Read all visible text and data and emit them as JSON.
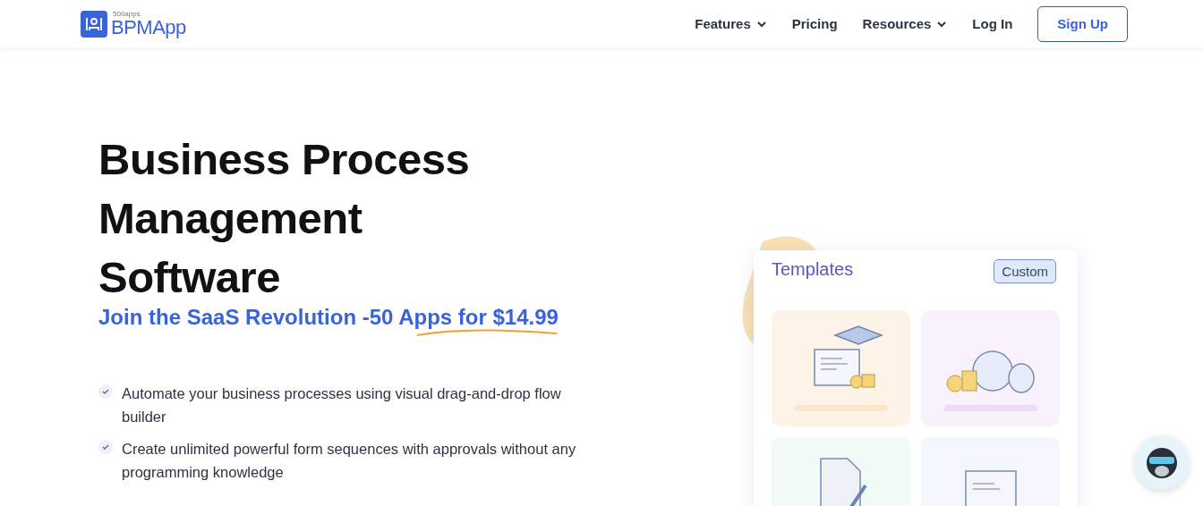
{
  "header": {
    "logo": {
      "tagline": "500apps",
      "name": "BPMApp"
    },
    "nav": [
      {
        "label": "Features",
        "has_dropdown": true
      },
      {
        "label": "Pricing",
        "has_dropdown": false
      },
      {
        "label": "Resources",
        "has_dropdown": true
      },
      {
        "label": "Log In",
        "has_dropdown": false
      }
    ],
    "cta": "Sign Up"
  },
  "hero": {
    "title": "Business Process Management Software",
    "subtitle": "Join the SaaS Revolution -50 Apps for $14.99",
    "features": [
      "Automate your business processes using visual drag-and-drop flow builder",
      "Create unlimited powerful form sequences with approvals without any programming knowledge"
    ]
  },
  "templates_card": {
    "title": "Templates",
    "button": "Custom",
    "tiles": [
      {
        "kind": "graduation",
        "color": "#fdf3e6"
      },
      {
        "kind": "money",
        "color": "#f9f2fd"
      },
      {
        "kind": "document",
        "color": "#f0fbf6"
      },
      {
        "kind": "scroll",
        "color": "#f3f6fd"
      }
    ]
  }
}
